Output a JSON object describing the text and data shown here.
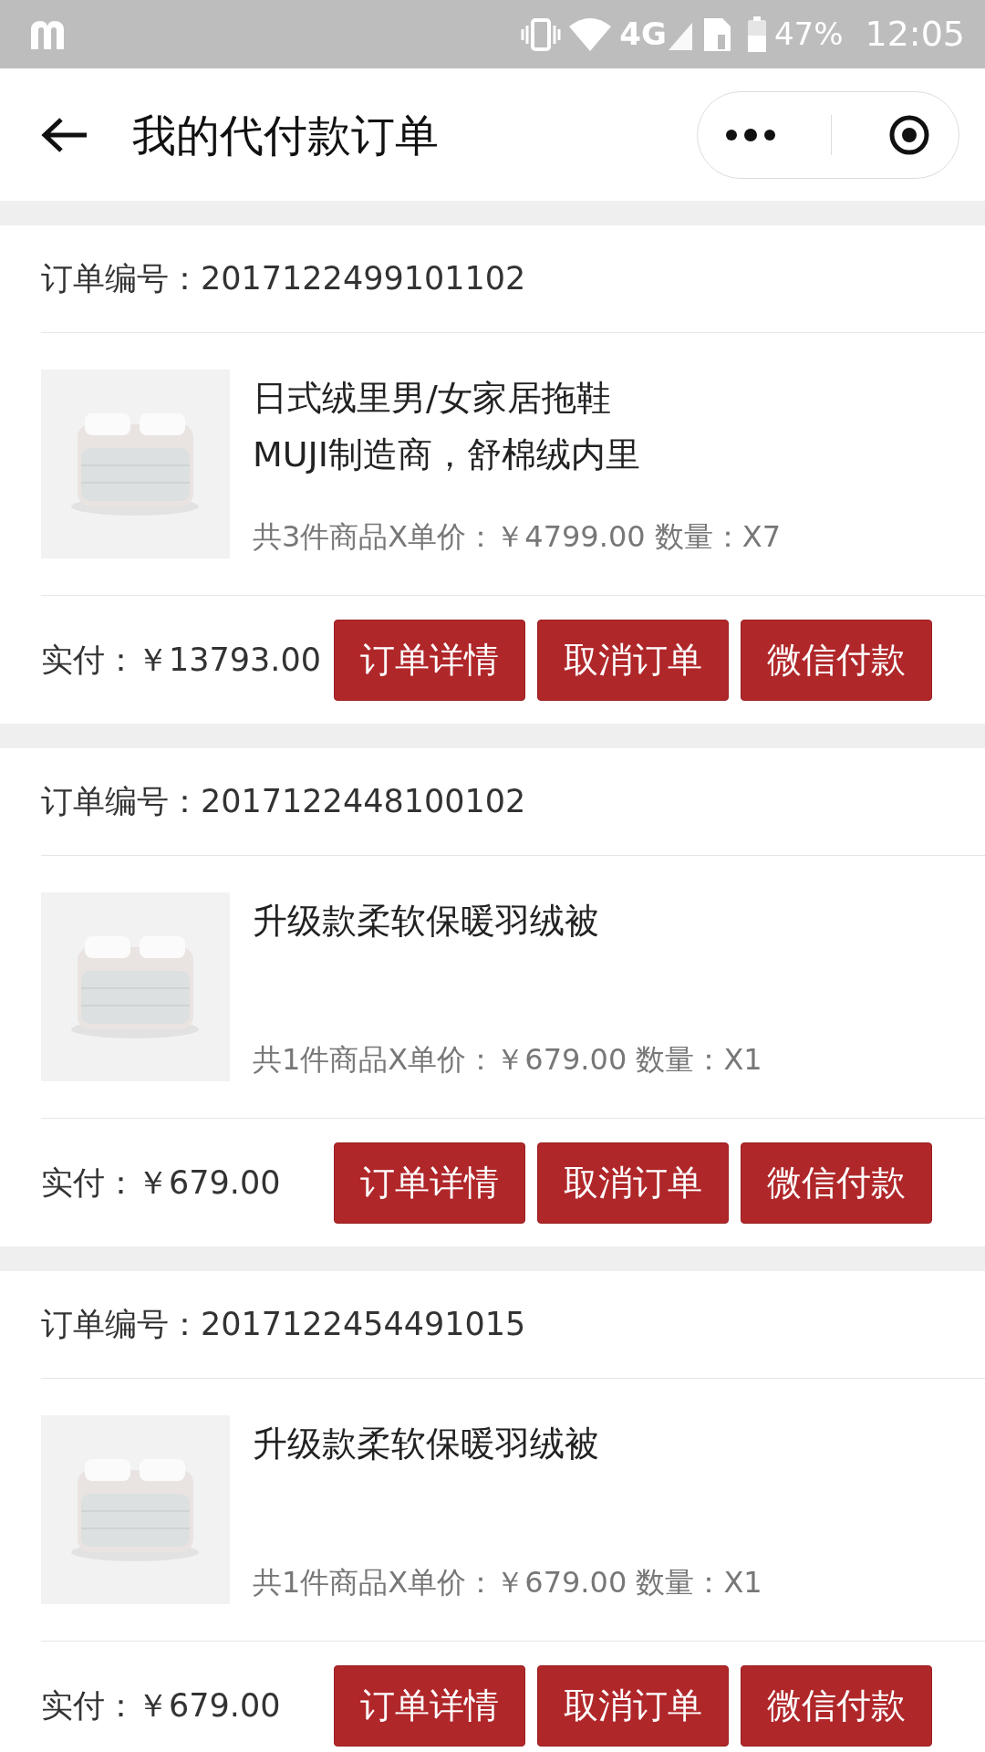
{
  "status_bar": {
    "network": "4G",
    "battery": "47%",
    "time": "12:05"
  },
  "header": {
    "title": "我的代付款订单"
  },
  "orders": [
    {
      "number_label": "订单编号：",
      "number": "2017122499101102",
      "title_lines": [
        "日式绒里男/女家居拖鞋",
        "MUJI制造商，舒棉绒内里"
      ],
      "meta": "共3件商品X单价：￥4799.00 数量：X7",
      "paid": "实付：￥13793.00",
      "buttons": [
        "订单详情",
        "取消订单",
        "微信付款"
      ]
    },
    {
      "number_label": "订单编号：",
      "number": "2017122448100102",
      "title_lines": [
        "升级款柔软保暖羽绒被"
      ],
      "meta": "共1件商品X单价：￥679.00 数量：X1",
      "paid": "实付：￥679.00",
      "buttons": [
        "订单详情",
        "取消订单",
        "微信付款"
      ]
    },
    {
      "number_label": "订单编号：",
      "number": "2017122454491015",
      "title_lines": [
        "升级款柔软保暖羽绒被"
      ],
      "meta": "共1件商品X单价：￥679.00 数量：X1",
      "paid": "实付：￥679.00",
      "buttons": [
        "订单详情",
        "取消订单",
        "微信付款"
      ]
    }
  ]
}
